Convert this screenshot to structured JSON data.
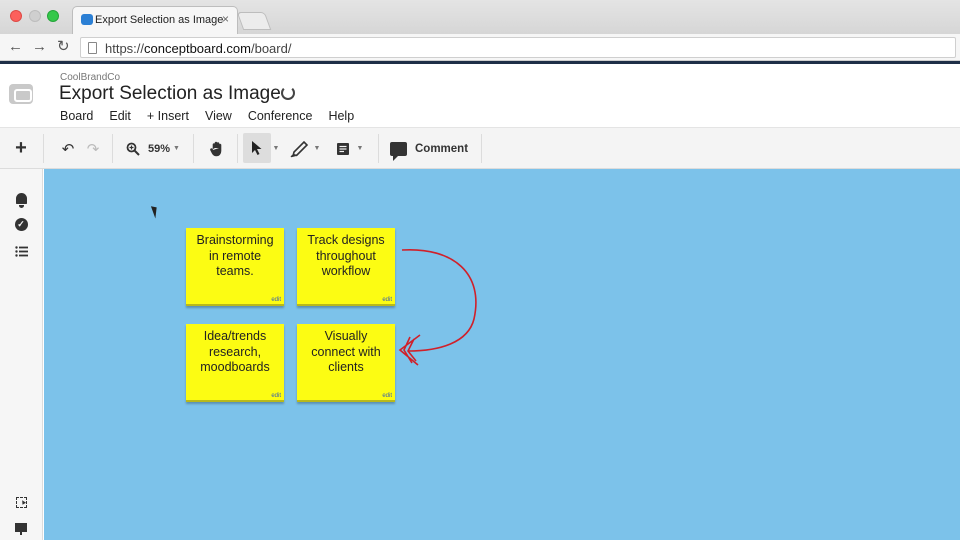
{
  "browser": {
    "tab_title": "Export Selection as Image",
    "url_prefix": "https://",
    "url_domain": "conceptboard.com",
    "url_path": "/board/"
  },
  "app": {
    "company": "CoolBrandCo",
    "board_title": "Export Selection as Image",
    "menu": [
      "Board",
      "Edit",
      "+ Insert",
      "View",
      "Conference",
      "Help"
    ]
  },
  "toolbar": {
    "zoom_level": "59%",
    "comment_label": "Comment"
  },
  "canvas": {
    "background": "#7cc2ea",
    "note_color": "#fcfc13",
    "notes": [
      {
        "text": "Brainstorming in remote teams.",
        "edit": "edit"
      },
      {
        "text": "Track designs throughout workflow",
        "edit": "edit"
      },
      {
        "text": "Idea/trends research, moodboards",
        "edit": "edit"
      },
      {
        "text": "Visually connect with clients",
        "edit": "edit"
      }
    ],
    "arrow_color": "#d0202a"
  },
  "icons": {
    "add": "plus-icon",
    "undo": "undo-icon",
    "redo": "redo-icon",
    "zoom": "zoom-icon",
    "hand": "hand-icon",
    "select": "pointer-icon",
    "pen": "pen-icon",
    "note": "sticky-note-icon",
    "comment": "comment-icon",
    "bell": "bell-icon",
    "check": "check-circle-icon",
    "list": "list-icon",
    "export": "selection-export-icon",
    "present": "presentation-icon"
  }
}
